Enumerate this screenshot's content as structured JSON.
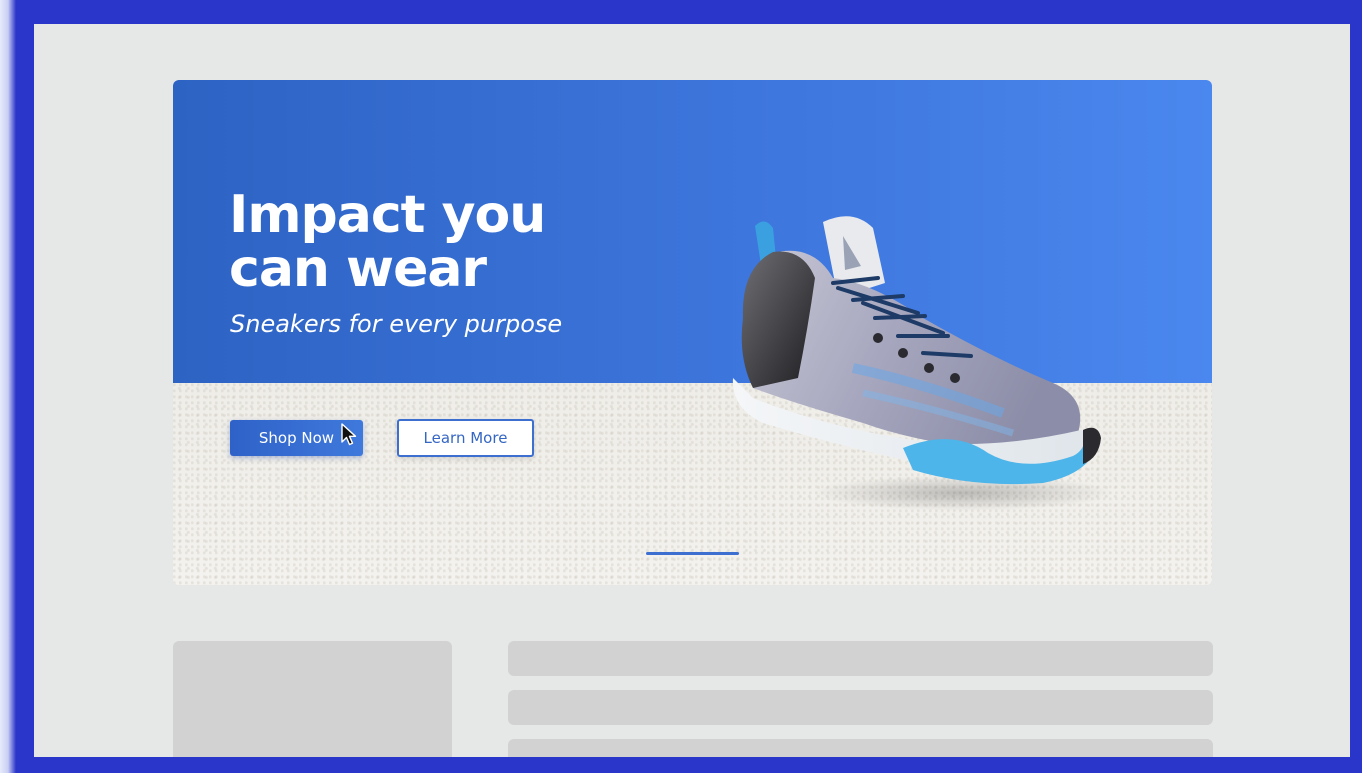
{
  "hero": {
    "headline": "Impact you can wear",
    "subheadline": "Sneakers for every purpose",
    "primary_button": "Shop Now",
    "secondary_button": "Learn More",
    "carousel_active_index": 1
  },
  "colors": {
    "frame": "#2a36c9",
    "hero_gradient_start": "#2d63c3",
    "hero_gradient_end": "#4a87ee",
    "accent": "#3d6fd0",
    "placeholder": "#d2d2d2"
  },
  "icons": {
    "cursor": "pointer-cursor-icon",
    "product": "sneaker-image"
  }
}
